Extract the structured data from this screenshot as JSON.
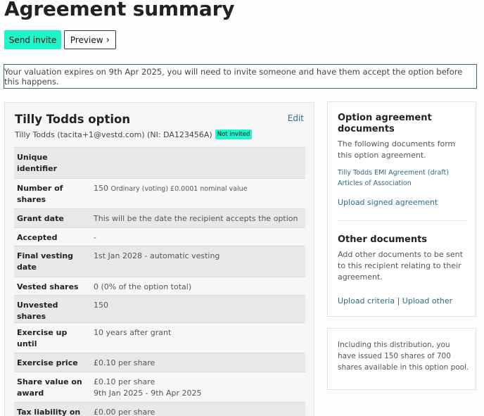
{
  "page": {
    "title": "Agreement summary",
    "send_invite": "Send invite",
    "preview": "Preview",
    "alert": "Your valuation expires on 9th Apr 2025, you will need to invite someone and have them accept the option before this happens."
  },
  "option": {
    "title": "Tilly Todds option",
    "edit": "Edit",
    "holder": "Tilly Todds (tacita+1@vestd.com) (NI: DA123456A)",
    "status_badge": "Not invited",
    "rows": [
      {
        "label": "Unique identifier",
        "value": ""
      },
      {
        "label": "Number of shares",
        "value": "150",
        "value_small": "Ordinary (voting) £0.0001 nominal value"
      },
      {
        "label": "Grant date",
        "value": "This will be the date the recipient accepts the option"
      },
      {
        "label": "Accepted",
        "value": "-"
      },
      {
        "label": "Final vesting date",
        "value": "1st Jan 2028 - automatic vesting"
      },
      {
        "label": "Vested shares",
        "value": "0 (0% of the option total)"
      },
      {
        "label": "Unvested shares",
        "value": "150"
      },
      {
        "label": "Exercise up until",
        "value": "10 years after grant"
      },
      {
        "label": "Exercise price",
        "value": "£0.10 per share"
      },
      {
        "label": "Share value on award",
        "value": "£0.10 per share",
        "value_line2": "9th Jan 2025 - 9th Apr 2025"
      },
      {
        "label": "Tax liability on exercise",
        "value": "£0.00 per share"
      }
    ]
  },
  "documents": {
    "title": "Option agreement documents",
    "text": "The following documents form this option agreement.",
    "links": [
      "Tilly Todds EMI Agreement (draft)",
      "Articles of Association"
    ],
    "upload_signed": "Upload signed agreement",
    "other_title": "Other documents",
    "other_text": "Add other documents to be sent to this recipient relating to their agreement.",
    "upload_criteria": "Upload criteria",
    "separator": "|",
    "upload_other": "Upload other"
  },
  "pool": {
    "text": "Including this distribution, you have issued 150 shares of 700 shares available in this option pool."
  }
}
